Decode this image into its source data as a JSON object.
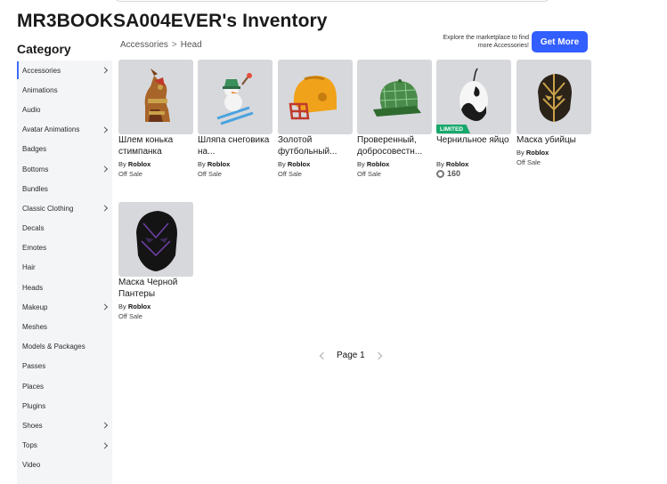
{
  "page": {
    "title": "MR3BOOKSA004EVER's Inventory"
  },
  "sidebar": {
    "heading": "Category",
    "items": [
      {
        "label": "Accessories",
        "chevron": true,
        "active": true
      },
      {
        "label": "Animations",
        "chevron": false
      },
      {
        "label": "Audio",
        "chevron": false
      },
      {
        "label": "Avatar Animations",
        "chevron": true
      },
      {
        "label": "Badges",
        "chevron": false
      },
      {
        "label": "Bottoms",
        "chevron": true
      },
      {
        "label": "Bundles",
        "chevron": false
      },
      {
        "label": "Classic Clothing",
        "chevron": true
      },
      {
        "label": "Decals",
        "chevron": false
      },
      {
        "label": "Emotes",
        "chevron": false
      },
      {
        "label": "Hair",
        "chevron": false
      },
      {
        "label": "Heads",
        "chevron": false
      },
      {
        "label": "Makeup",
        "chevron": true
      },
      {
        "label": "Meshes",
        "chevron": false
      },
      {
        "label": "Models & Packages",
        "chevron": false
      },
      {
        "label": "Passes",
        "chevron": false
      },
      {
        "label": "Places",
        "chevron": false
      },
      {
        "label": "Plugins",
        "chevron": false
      },
      {
        "label": "Shoes",
        "chevron": true
      },
      {
        "label": "Tops",
        "chevron": true
      },
      {
        "label": "Video",
        "chevron": false
      }
    ]
  },
  "breadcrumb": {
    "root": "Accessories",
    "separator": ">",
    "current": "Head"
  },
  "promo": {
    "text": "Explore the marketplace to find more Accessories!",
    "button": "Get More"
  },
  "items": [
    {
      "name": "Шлем конька стимпанка",
      "by": "By",
      "creator": "Roblox",
      "price": "Off Sale",
      "icon": "steampunk-horse-helmet-icon"
    },
    {
      "name": "Шляпа снеговика на...",
      "by": "By",
      "creator": "Roblox",
      "price": "Off Sale",
      "icon": "snowman-hat-icon"
    },
    {
      "name": "Золотой футбольный...",
      "by": "By",
      "creator": "Roblox",
      "price": "Off Sale",
      "icon": "gold-football-helmet-icon"
    },
    {
      "name": "Проверенный, добросовестн...",
      "by": "By",
      "creator": "Roblox",
      "price": "Off Sale",
      "icon": "green-plaid-cap-icon"
    },
    {
      "name": "Чернильное яйцо",
      "by": "By",
      "creator": "Roblox",
      "price": "160",
      "limited": "LIMITED",
      "icon": "ink-egg-icon"
    },
    {
      "name": "Маска убийцы",
      "by": "By",
      "creator": "Roblox",
      "price": "Off Sale",
      "icon": "killmonger-mask-icon"
    },
    {
      "name": "Маска Черной Пантеры",
      "by": "By",
      "creator": "Roblox",
      "price": "Off Sale",
      "icon": "black-panther-mask-icon"
    }
  ],
  "pager": {
    "label": "Page 1"
  },
  "colors": {
    "accent": "#335fff",
    "limited": "#17a86b",
    "thumb_bg": "#d7d8dc",
    "sidebar_bg": "#f4f5f7"
  }
}
